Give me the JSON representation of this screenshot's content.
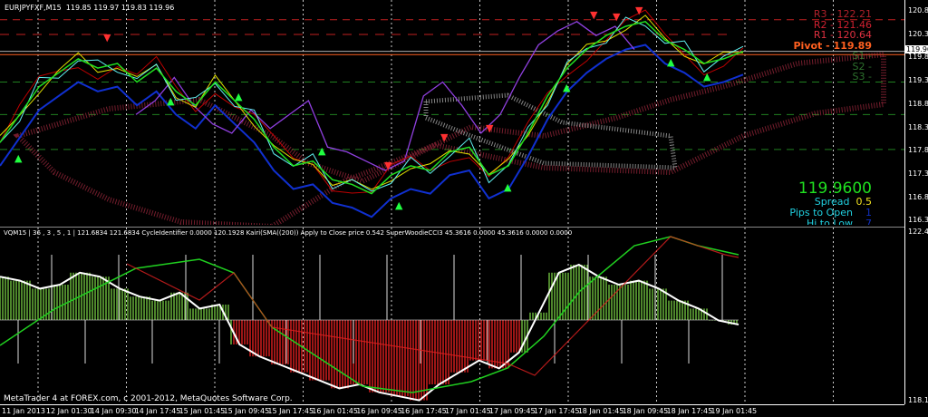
{
  "header": {
    "symbol": "EURJPYFXF,M15",
    "ohlc": "119.85 119.97 119.83 119.96"
  },
  "pivots": [
    {
      "label": "R3 - 122.21",
      "color": "#b0202a"
    },
    {
      "label": "R2 - 121.46",
      "color": "#d02030"
    },
    {
      "label": "R1 - 120.64",
      "color": "#e03040"
    },
    {
      "label": "Pivot - 119.89",
      "color": "#ff6020"
    },
    {
      "label": "S1 -",
      "color": "#40a040"
    },
    {
      "label": "S2 -",
      "color": "#40a040"
    },
    {
      "label": "S3 -",
      "color": "#40a040"
    }
  ],
  "info": {
    "price": "119.9600",
    "spread_label": "Spread",
    "spread": "0.5",
    "pips_label": "Pips to Open",
    "pips": "1",
    "hilo_label": "Hi to Low",
    "hilo": "7"
  },
  "price_axis": [
    "120.85",
    "120.35",
    "119.85",
    "119.35",
    "118.85",
    "118.35",
    "117.85",
    "117.35",
    "116.85",
    "116.35"
  ],
  "current_price": "119.96",
  "sub_header": "VQM15 | 36 , 3 , 5 , 1 |  121.6834 121.6834  CycleIdentifier 0.0000 120.1928  Kairi(SMA((200)) Apply to Close price 0.542  SuperWoodieCCI3 45.3616 0.0000 45.3616 0.0000 0.0000",
  "sub_axis": {
    "top": "122.418",
    "bottom": "118.105"
  },
  "copyright": "MetaTrader 4 at FOREX.com, c 2001-2012, MetaQuotes Software Corp.",
  "time_axis": [
    "11 Jan 2013",
    "12 Jan 01:30",
    "14 Jan 09:30",
    "14 Jan 17:45",
    "15 Jan 01:45",
    "15 Jan 09:45",
    "15 Jan 17:45",
    "16 Jan 01:45",
    "16 Jan 09:45",
    "16 Jan 17:45",
    "17 Jan 01:45",
    "17 Jan 09:45",
    "17 Jan 17:45",
    "18 Jan 01:45",
    "18 Jan 09:45",
    "18 Jan 17:45",
    "19 Jan 01:45"
  ],
  "series": {
    "close": [
      118.0,
      118.6,
      119.2,
      119.5,
      119.8,
      119.6,
      119.7,
      119.3,
      119.6,
      119.1,
      118.8,
      119.3,
      118.9,
      118.5,
      117.9,
      117.5,
      117.6,
      117.2,
      117.1,
      116.9,
      117.3,
      117.5,
      117.4,
      117.8,
      117.9,
      117.3,
      117.5,
      118.2,
      119.0,
      119.6,
      120.0,
      120.3,
      120.5,
      120.6,
      120.2,
      120.0,
      119.7,
      119.8,
      119.96
    ],
    "purple": [
      118.6,
      118.9,
      119.4,
      118.8,
      118.4,
      118.2,
      118.7,
      118.3,
      118.6,
      118.9,
      117.9,
      117.8,
      117.6,
      117.4,
      117.6,
      119.0,
      119.3,
      118.8,
      118.2,
      118.6,
      119.4,
      120.1,
      120.4,
      120.6,
      120.3,
      120.5,
      120.0
    ],
    "indicator": [
      121.3,
      121.2,
      121.0,
      121.1,
      121.4,
      121.3,
      121.0,
      120.8,
      120.7,
      120.9,
      120.5,
      120.6,
      119.6,
      119.3,
      119.1,
      118.9,
      118.7,
      118.5,
      118.6,
      118.4,
      118.3,
      118.2,
      118.6,
      118.9,
      119.2,
      119.0,
      119.4,
      120.4,
      121.4,
      121.6,
      121.3,
      121.1,
      121.2,
      121.0,
      120.7,
      120.5,
      120.2,
      120.1
    ]
  }
}
